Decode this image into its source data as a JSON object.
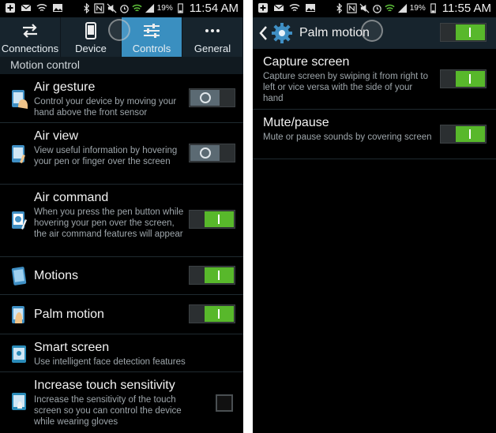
{
  "left_screen": {
    "status": {
      "battery": "19%",
      "time": "11:54 AM"
    },
    "tabs": [
      {
        "label": "Connections",
        "icon": "swap-arrows-icon",
        "active": false
      },
      {
        "label": "Device",
        "icon": "phone-icon",
        "active": false
      },
      {
        "label": "Controls",
        "icon": "sliders-icon",
        "active": true
      },
      {
        "label": "General",
        "icon": "more-dots-icon",
        "active": false
      }
    ],
    "section_header": "Motion control",
    "items": [
      {
        "title": "Air gesture",
        "desc": "Control your device by moving your hand above the front sensor",
        "control": "off"
      },
      {
        "title": "Air view",
        "desc": "View useful information by hovering your pen or finger over the screen",
        "control": "off"
      },
      {
        "title": "Air command",
        "desc": "When you press the pen button while hovering your pen over the screen, the air command features will appear",
        "control": "on"
      },
      {
        "title": "Motions",
        "desc": "",
        "control": "on"
      },
      {
        "title": "Palm motion",
        "desc": "",
        "control": "on"
      },
      {
        "title": "Smart screen",
        "desc": "Use intelligent face detection features",
        "control": "none"
      },
      {
        "title": "Increase touch sensitivity",
        "desc": "Increase the sensitivity of the touch screen so you can control the device while wearing gloves",
        "control": "checkbox-unchecked"
      }
    ]
  },
  "right_screen": {
    "status": {
      "battery": "19%",
      "time": "11:55 AM"
    },
    "header": {
      "title": "Palm motion",
      "master_toggle": "on"
    },
    "items": [
      {
        "title": "Capture screen",
        "desc": "Capture screen by swiping it from right to left or vice versa with the side of your hand",
        "control": "on"
      },
      {
        "title": "Mute/pause",
        "desc": "Mute or pause sounds by covering screen",
        "control": "on"
      }
    ]
  },
  "colors": {
    "background": "#000000",
    "header_bg": "#17242d",
    "active_tab": "#3a8fc0",
    "toggle_on": "#58b82b",
    "toggle_off": "#5b6a73",
    "description_text": "#9ea6ab"
  }
}
